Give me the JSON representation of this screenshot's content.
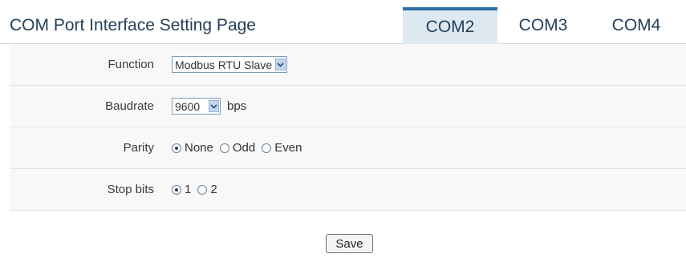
{
  "page": {
    "title": "COM Port Interface Setting Page"
  },
  "tabs": [
    {
      "label": "COM2",
      "active": true
    },
    {
      "label": "COM3",
      "active": false
    },
    {
      "label": "COM4",
      "active": false
    }
  ],
  "form": {
    "function": {
      "label": "Function",
      "selected": "Modbus RTU Slave"
    },
    "baudrate": {
      "label": "Baudrate",
      "selected": "9600",
      "unit": "bps"
    },
    "parity": {
      "label": "Parity",
      "options": [
        {
          "label": "None",
          "checked": true
        },
        {
          "label": "Odd",
          "checked": false
        },
        {
          "label": "Even",
          "checked": false
        }
      ]
    },
    "stop_bits": {
      "label": "Stop bits",
      "options": [
        {
          "label": "1",
          "checked": true
        },
        {
          "label": "2",
          "checked": false
        }
      ]
    }
  },
  "actions": {
    "save_label": "Save"
  },
  "colors": {
    "accent": "#2d6fa5",
    "active_tab_bg": "#dde8f1",
    "title_text": "#24405a"
  },
  "icons": {
    "select_arrow": "chevron-down-icon",
    "radio": "radio-button"
  }
}
